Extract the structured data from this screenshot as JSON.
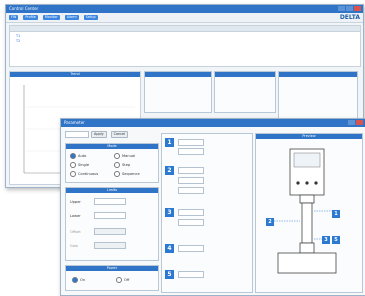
{
  "back_window": {
    "title": "Control Center",
    "brand": "DELTA",
    "toolbar": [
      "FW",
      "Profile",
      "Monitor",
      "Alarm",
      "Setup"
    ],
    "tabs": [
      "Parameter",
      "Status",
      "Trend",
      "Log"
    ],
    "chart_title": "Trend",
    "left_panel_items": [
      "T1",
      "T2"
    ]
  },
  "front_window": {
    "title": "Parameter",
    "top_buttons": [
      "Apply",
      "Cancel"
    ],
    "sections": {
      "mode_header": "Mode",
      "modes": [
        "Auto",
        "Manual",
        "Single",
        "Step",
        "Continuous",
        "Sequence"
      ],
      "limits_header": "Limits",
      "limit_rows": [
        "Upper",
        "Lower",
        "Offset",
        "Gain"
      ],
      "power_header": "Power",
      "power_options": [
        "On",
        "Off"
      ]
    },
    "steps": [
      "1",
      "2",
      "3",
      "4",
      "5"
    ],
    "preview_title": "Preview",
    "callouts": [
      "1",
      "2",
      "3",
      "5"
    ],
    "accent": "#2f74c6"
  }
}
